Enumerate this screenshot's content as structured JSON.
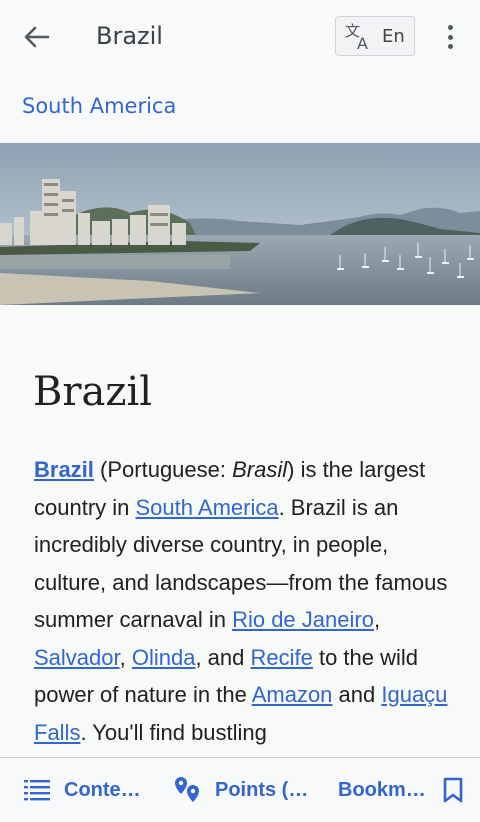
{
  "appbar": {
    "title": "Brazil",
    "language_code": "En"
  },
  "breadcrumb": "South America",
  "article": {
    "heading": "Brazil",
    "paragraph": [
      {
        "t": "Brazil",
        "link": true,
        "bold": true
      },
      {
        "t": " (Portuguese: "
      },
      {
        "t": "Brasil",
        "italic": true
      },
      {
        "t": ") is the largest country in "
      },
      {
        "t": "South America",
        "link": true
      },
      {
        "t": ". Brazil is an incredibly diverse country, in people, culture, and landscapes—from the famous summer carnaval in "
      },
      {
        "t": "Rio de Janeiro",
        "link": true
      },
      {
        "t": ", "
      },
      {
        "t": "Salvador",
        "link": true
      },
      {
        "t": ", "
      },
      {
        "t": "Olinda",
        "link": true
      },
      {
        "t": ", and "
      },
      {
        "t": "Recife",
        "link": true
      },
      {
        "t": " to the wild power of nature in the "
      },
      {
        "t": "Amazon",
        "link": true
      },
      {
        "t": " and "
      },
      {
        "t": "Iguaçu Falls",
        "link": true
      },
      {
        "t": ". You'll find bustling"
      }
    ]
  },
  "bottom_nav": {
    "contents_label": "Conte…",
    "points_label": "Points (…",
    "bookmarks_label": "Bookm…"
  },
  "icons": {
    "back": "arrow-left-icon",
    "translate": "translate-icon",
    "more": "more-vertical-icon",
    "contents": "list-icon",
    "points": "map-pins-icon",
    "bookmark": "bookmark-icon"
  },
  "colors": {
    "link": "#3366cc",
    "text": "#202122",
    "bar": "#f8f9fa"
  }
}
